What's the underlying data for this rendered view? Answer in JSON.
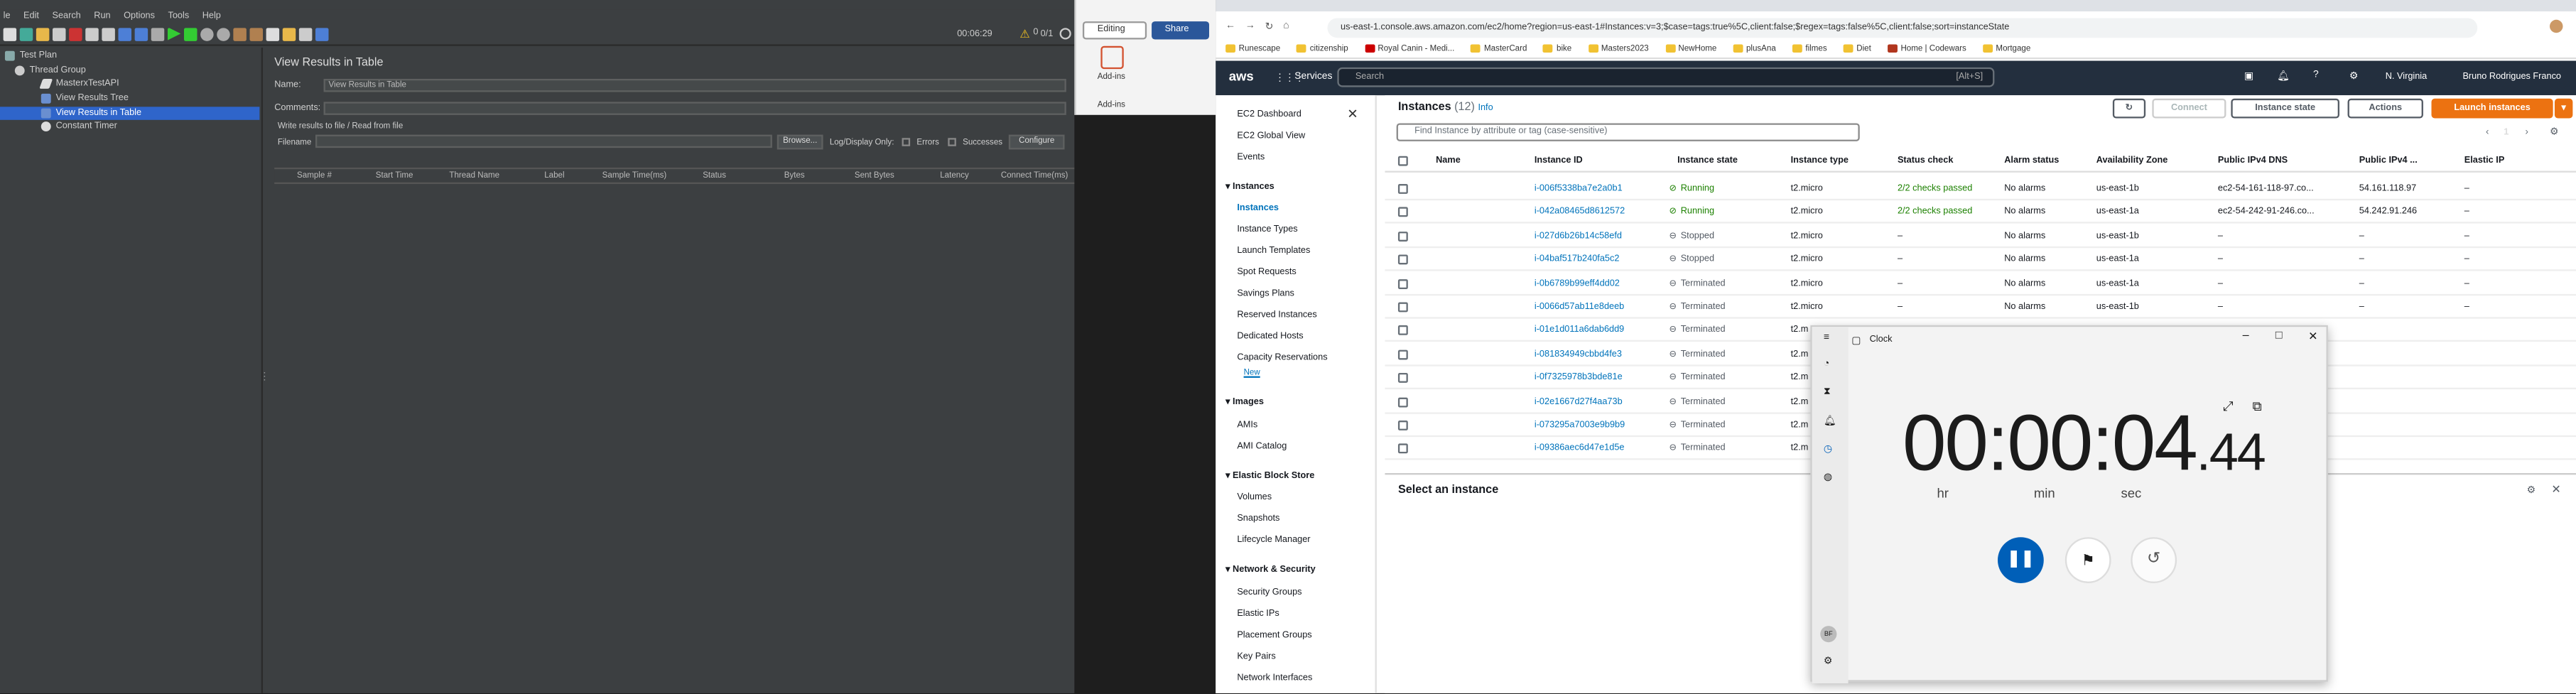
{
  "jmeter": {
    "menu": [
      "le",
      "Edit",
      "Search",
      "Run",
      "Options",
      "Tools",
      "Help"
    ],
    "timer": "00:06:29",
    "count": "0/1",
    "tree": [
      "Test Plan",
      "Thread Group",
      "MasterxTestAPI",
      "View Results Tree",
      "View Results in Table",
      "Constant Timer"
    ],
    "panel_title": "View Results in Table",
    "name_label": "Name:",
    "name_value": "View Results in Table",
    "comments_label": "Comments:",
    "write_label": "Write results to file / Read from file",
    "filename_label": "Filename",
    "browse": "Browse...",
    "log_label": "Log/Display Only:",
    "errors": "Errors",
    "successes": "Successes",
    "configure": "Configure",
    "columns": [
      "Sample #",
      "Start Time",
      "Thread Name",
      "Label",
      "Sample Time(ms)",
      "Status",
      "Bytes",
      "Sent Bytes",
      "Latency",
      "Connect Time(ms)"
    ]
  },
  "word": {
    "editing": "Editing",
    "share": "Share",
    "addins": "Add-ins",
    "addins2": "Add-ins"
  },
  "chrome": {
    "url": "us-east-1.console.aws.amazon.com/ec2/home?region=us-east-1#Instances:v=3;$case=tags:true%5C,client:false;$regex=tags:false%5C,client:false;sort=instanceState",
    "bookmarks": [
      "Runescape",
      "citizenship",
      "Royal Canin - Medi...",
      "MasterCard",
      "bike",
      "Masters2023",
      "NewHome",
      "plusAna",
      "filmes",
      "Diet",
      "Home | Codewars",
      "Mortgage"
    ]
  },
  "aws": {
    "logo": "aws",
    "services": "Services",
    "search": "Search",
    "shortcut": "[Alt+S]",
    "region": "N. Virginia",
    "user": "Bruno Rodrigues Franco",
    "nav": {
      "top": [
        "EC2 Dashboard",
        "EC2 Global View",
        "Events"
      ],
      "instances_h": "Instances",
      "instances": [
        "Instances",
        "Instance Types",
        "Launch Templates",
        "Spot Requests",
        "Savings Plans",
        "Reserved Instances",
        "Dedicated Hosts",
        "Capacity Reservations"
      ],
      "new_badge": "New",
      "images_h": "Images",
      "images": [
        "AMIs",
        "AMI Catalog"
      ],
      "ebs_h": "Elastic Block Store",
      "ebs": [
        "Volumes",
        "Snapshots",
        "Lifecycle Manager"
      ],
      "net_h": "Network & Security",
      "net": [
        "Security Groups",
        "Elastic IPs",
        "Placement Groups",
        "Key Pairs",
        "Network Interfaces"
      ]
    },
    "title": "Instances",
    "count": "(12)",
    "info": "Info",
    "filter_placeholder": "Find Instance by attribute or tag (case-sensitive)",
    "connect": "Connect",
    "state_btn": "Instance state",
    "actions": "Actions",
    "launch": "Launch instances",
    "page": "1",
    "headers": [
      "Name",
      "Instance ID",
      "Instance state",
      "Instance type",
      "Status check",
      "Alarm status",
      "Availability Zone",
      "Public IPv4 DNS",
      "Public IPv4 ...",
      "Elastic IP"
    ],
    "rows": [
      {
        "id": "i-006f5338ba7e2a0b1",
        "state": "Running",
        "type": "t2.micro",
        "check": "2/2 checks passed",
        "alarm": "No alarms",
        "az": "us-east-1b",
        "dns": "ec2-54-161-118-97.co...",
        "ip": "54.161.118.97",
        "eip": "–"
      },
      {
        "id": "i-042a08465d8612572",
        "state": "Running",
        "type": "t2.micro",
        "check": "2/2 checks passed",
        "alarm": "No alarms",
        "az": "us-east-1a",
        "dns": "ec2-54-242-91-246.co...",
        "ip": "54.242.91.246",
        "eip": "–"
      },
      {
        "id": "i-027d6b26b14c58efd",
        "state": "Stopped",
        "type": "t2.micro",
        "check": "–",
        "alarm": "No alarms",
        "az": "us-east-1b",
        "dns": "–",
        "ip": "–",
        "eip": "–"
      },
      {
        "id": "i-04baf517b240fa5c2",
        "state": "Stopped",
        "type": "t2.micro",
        "check": "–",
        "alarm": "No alarms",
        "az": "us-east-1a",
        "dns": "–",
        "ip": "–",
        "eip": "–"
      },
      {
        "id": "i-0b6789b99eff4dd02",
        "state": "Terminated",
        "type": "t2.micro",
        "check": "–",
        "alarm": "No alarms",
        "az": "us-east-1a",
        "dns": "–",
        "ip": "–",
        "eip": "–"
      },
      {
        "id": "i-0066d57ab11e8deeb",
        "state": "Terminated",
        "type": "t2.micro",
        "check": "–",
        "alarm": "No alarms",
        "az": "us-east-1b",
        "dns": "–",
        "ip": "–",
        "eip": "–"
      },
      {
        "id": "i-01e1d011a6dab6dd9",
        "state": "Terminated",
        "type": "t2.m",
        "check": "",
        "alarm": "",
        "az": "",
        "dns": "",
        "ip": "",
        "eip": ""
      },
      {
        "id": "i-081834949cbbd4fe3",
        "state": "Terminated",
        "type": "t2.m",
        "check": "",
        "alarm": "",
        "az": "",
        "dns": "",
        "ip": "",
        "eip": ""
      },
      {
        "id": "i-0f7325978b3bde81e",
        "state": "Terminated",
        "type": "t2.m",
        "check": "",
        "alarm": "",
        "az": "",
        "dns": "",
        "ip": "",
        "eip": ""
      },
      {
        "id": "i-02e1667d27f4aa73b",
        "state": "Terminated",
        "type": "t2.m",
        "check": "",
        "alarm": "",
        "az": "",
        "dns": "",
        "ip": "",
        "eip": ""
      },
      {
        "id": "i-073295a7003e9b9b9",
        "state": "Terminated",
        "type": "t2.m",
        "check": "",
        "alarm": "",
        "az": "",
        "dns": "",
        "ip": "",
        "eip": ""
      },
      {
        "id": "i-09386aec6d47e1d5e",
        "state": "Terminated",
        "type": "t2.m",
        "check": "",
        "alarm": "",
        "az": "",
        "dns": "",
        "ip": "",
        "eip": ""
      }
    ],
    "select_title": "Select an instance"
  },
  "clock": {
    "title": "Clock",
    "hh": "00",
    "mm": "00",
    "ss": "04",
    "frac": ".44",
    "hr": "hr",
    "min": "min",
    "sec": "sec",
    "avatar": "BF"
  }
}
